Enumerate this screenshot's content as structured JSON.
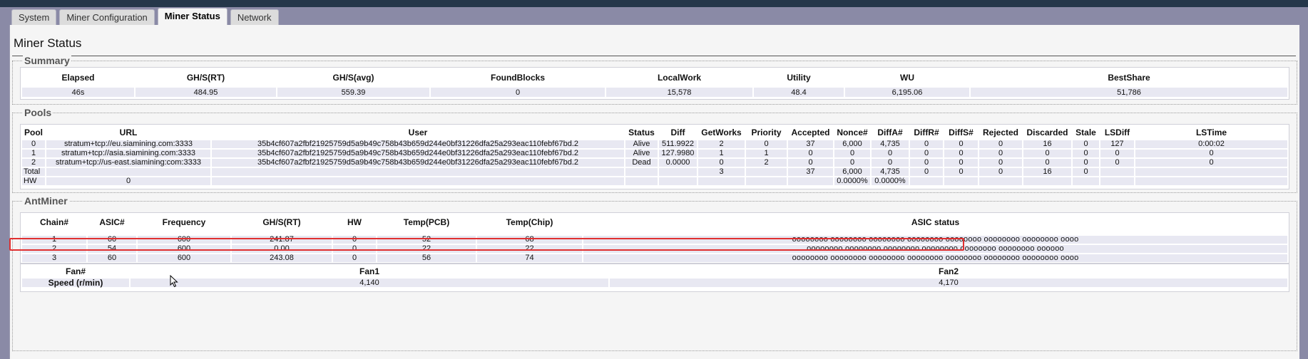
{
  "tabs": [
    {
      "label": "System"
    },
    {
      "label": "Miner Configuration"
    },
    {
      "label": "Miner Status"
    },
    {
      "label": "Network"
    }
  ],
  "page": {
    "title": "Miner Status"
  },
  "summary": {
    "legend": "Summary",
    "headers": [
      "Elapsed",
      "GH/S(RT)",
      "GH/S(avg)",
      "FoundBlocks",
      "LocalWork",
      "Utility",
      "WU",
      "BestShare"
    ],
    "values": [
      "46s",
      "484.95",
      "559.39",
      "0",
      "15,578",
      "48.4",
      "6,195.06",
      "51,786"
    ]
  },
  "pools": {
    "legend": "Pools",
    "headers": [
      "Pool",
      "URL",
      "User",
      "Status",
      "Diff",
      "GetWorks",
      "Priority",
      "Accepted",
      "Nonce#",
      "DiffA#",
      "DiffR#",
      "DiffS#",
      "Rejected",
      "Discarded",
      "Stale",
      "LSDiff",
      "LSTime"
    ],
    "rows": [
      [
        "0",
        "stratum+tcp://eu.siamining.com:3333",
        "35b4cf607a2fbf21925759d5a9b49c758b43b659d244e0bf31226dfa25a293eac110febf67bd.2",
        "Alive",
        "511.9922",
        "2",
        "0",
        "37",
        "6,000",
        "4,735",
        "0",
        "0",
        "0",
        "16",
        "0",
        "127",
        "0:00:02"
      ],
      [
        "1",
        "stratum+tcp://asia.siamining.com:3333",
        "35b4cf607a2fbf21925759d5a9b49c758b43b659d244e0bf31226dfa25a293eac110febf67bd.2",
        "Alive",
        "127.9980",
        "1",
        "1",
        "0",
        "0",
        "0",
        "0",
        "0",
        "0",
        "0",
        "0",
        "0",
        "0"
      ],
      [
        "2",
        "stratum+tcp://us-east.siamining:com:3333",
        "35b4cf607a2fbf21925759d5a9b49c758b43b659d244e0bf31226dfa25a293eac110febf67bd.2",
        "Dead",
        "0.0000",
        "0",
        "2",
        "0",
        "0",
        "0",
        "0",
        "0",
        "0",
        "0",
        "0",
        "0",
        "0"
      ],
      [
        "Total",
        "",
        "",
        "",
        "",
        "3",
        "",
        "37",
        "6,000",
        "4,735",
        "0",
        "0",
        "0",
        "16",
        "0",
        "",
        ""
      ],
      [
        "HW",
        "0",
        "",
        "",
        "",
        "",
        "",
        "",
        "0.0000%",
        "0.0000%",
        "",
        "",
        "",
        "",
        "",
        "",
        ""
      ]
    ]
  },
  "antminer": {
    "legend": "AntMiner",
    "headers": [
      "Chain#",
      "ASIC#",
      "Frequency",
      "GH/S(RT)",
      "HW",
      "Temp(PCB)",
      "Temp(Chip)",
      "ASIC status"
    ],
    "rows": [
      [
        "1",
        "60",
        "600",
        "241.87",
        "0",
        "52",
        "68",
        "oooooooo oooooooo oooooooo oooooooo oooooooo oooooooo oooooooo oooo"
      ],
      [
        "2",
        "54",
        "600",
        "0.00",
        "0",
        "22",
        "22",
        "oooooooo oooooooo oooooooo oooooooo oooooooo oooooooo oooooo"
      ],
      [
        "3",
        "60",
        "600",
        "243.08",
        "0",
        "56",
        "74",
        "oooooooo oooooooo oooooooo oooooooo oooooooo oooooooo oooooooo oooo"
      ]
    ],
    "fans": {
      "headers": [
        "Fan#",
        "Fan1",
        "Fan2"
      ],
      "label": "Speed (r/min)",
      "values": [
        "4,140",
        "4,170"
      ]
    }
  },
  "colors": {
    "highlight": "#e03030",
    "background": "#8a8aa6",
    "panel": "#f5f5f5",
    "row": "#e8e8f2"
  }
}
